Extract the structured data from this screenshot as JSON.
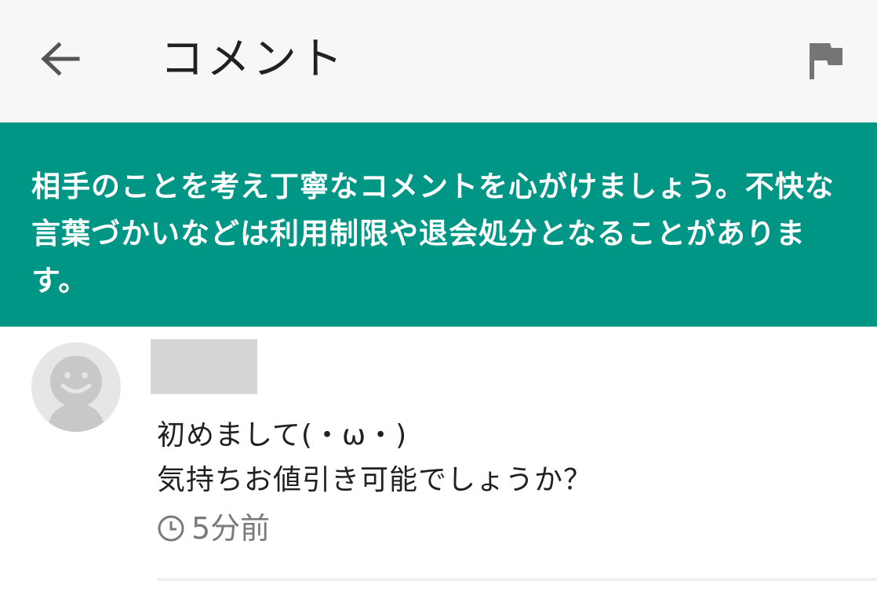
{
  "header": {
    "title": "コメント",
    "back_icon": "arrow-left-icon",
    "flag_icon": "flag-icon"
  },
  "notice": {
    "text": "相手のことを考え丁寧なコメントを心がけましょう。不快な言葉づかいなどは利用制限や退会処分となることがあります。"
  },
  "comment": {
    "avatar_icon": "default-avatar-icon",
    "username": "",
    "lines": [
      "初めまして(・ω・)",
      "気持ちお値引き可能でしょうか？"
    ],
    "timestamp_icon": "clock-icon",
    "timestamp": "5分前"
  },
  "colors": {
    "header_bg": "#f7f7f7",
    "notice_bg": "#009686",
    "avatar_bg": "#e6e6e6",
    "username_redaction": "#d6d6d6",
    "muted_text": "#7a7a7a"
  }
}
